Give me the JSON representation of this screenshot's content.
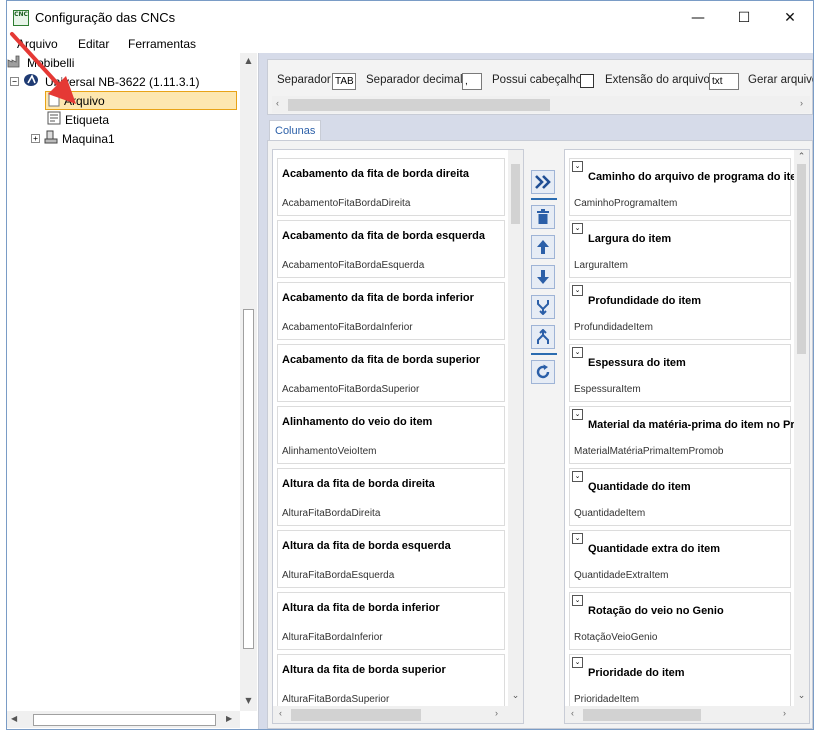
{
  "window": {
    "title": "Configuração das CNCs",
    "icon_text": "CNC",
    "minimize": "—",
    "maximize": "☐",
    "close": "✕"
  },
  "menu": {
    "items": [
      "Arquivo",
      "Editar",
      "Ferramentas"
    ]
  },
  "tree": {
    "root": "Mobibelli",
    "node1": "Universal NB-3622 (1.11.3.1)",
    "child_arquivo": "Arquivo",
    "child_etiqueta": "Etiqueta",
    "node2": "Maquina1",
    "expander_open": "−",
    "expander_closed": "+"
  },
  "options": {
    "separador_label": "Separador",
    "separador_value": "TAB",
    "separador_decimal_label": "Separador decimal",
    "separador_decimal_value": ",",
    "possui_cabecalho_label": "Possui cabeçalho",
    "extensao_label": "Extensão do arquivo",
    "extensao_value": "txt",
    "gerar_label": "Gerar arquivo"
  },
  "tab": {
    "label": "Colunas"
  },
  "available_columns": [
    {
      "title": "Acabamento da fita de borda direita",
      "key": "AcabamentoFitaBordaDireita"
    },
    {
      "title": "Acabamento da fita de borda esquerda",
      "key": "AcabamentoFitaBordaEsquerda"
    },
    {
      "title": "Acabamento da fita de borda inferior",
      "key": "AcabamentoFitaBordaInferior"
    },
    {
      "title": "Acabamento da fita de borda superior",
      "key": "AcabamentoFitaBordaSuperior"
    },
    {
      "title": "Alinhamento do veio do item",
      "key": "AlinhamentoVeioItem"
    },
    {
      "title": "Altura da fita de borda direita",
      "key": "AlturaFitaBordaDireita"
    },
    {
      "title": "Altura da fita de borda esquerda",
      "key": "AlturaFitaBordaEsquerda"
    },
    {
      "title": "Altura da fita de borda inferior",
      "key": "AlturaFitaBordaInferior"
    },
    {
      "title": "Altura da fita de borda superior",
      "key": "AlturaFitaBordaSuperior"
    }
  ],
  "selected_columns": [
    {
      "title": "Caminho do arquivo de programa do item",
      "key": "CaminhoProgramaItem"
    },
    {
      "title": "Largura do item",
      "key": "LarguraItem"
    },
    {
      "title": "Profundidade do item",
      "key": "ProfundidadeItem"
    },
    {
      "title": "Espessura do item",
      "key": "EspessuraItem"
    },
    {
      "title": "Material da matéria-prima do item no Promob",
      "key": "MaterialMatériaPrimaItemPromob"
    },
    {
      "title": "Quantidade do item",
      "key": "QuantidadeItem"
    },
    {
      "title": "Quantidade extra do item",
      "key": "QuantidadeExtraItem"
    },
    {
      "title": "Rotação do veio no Genio",
      "key": "RotaçãoVeioGenio"
    },
    {
      "title": "Prioridade do item",
      "key": "PrioridadeItem"
    }
  ],
  "colors": {
    "accent": "#2b6cb0",
    "selection_bg": "#fde7b0",
    "selection_border": "#e8a317",
    "annotation_arrow": "#e53935"
  }
}
